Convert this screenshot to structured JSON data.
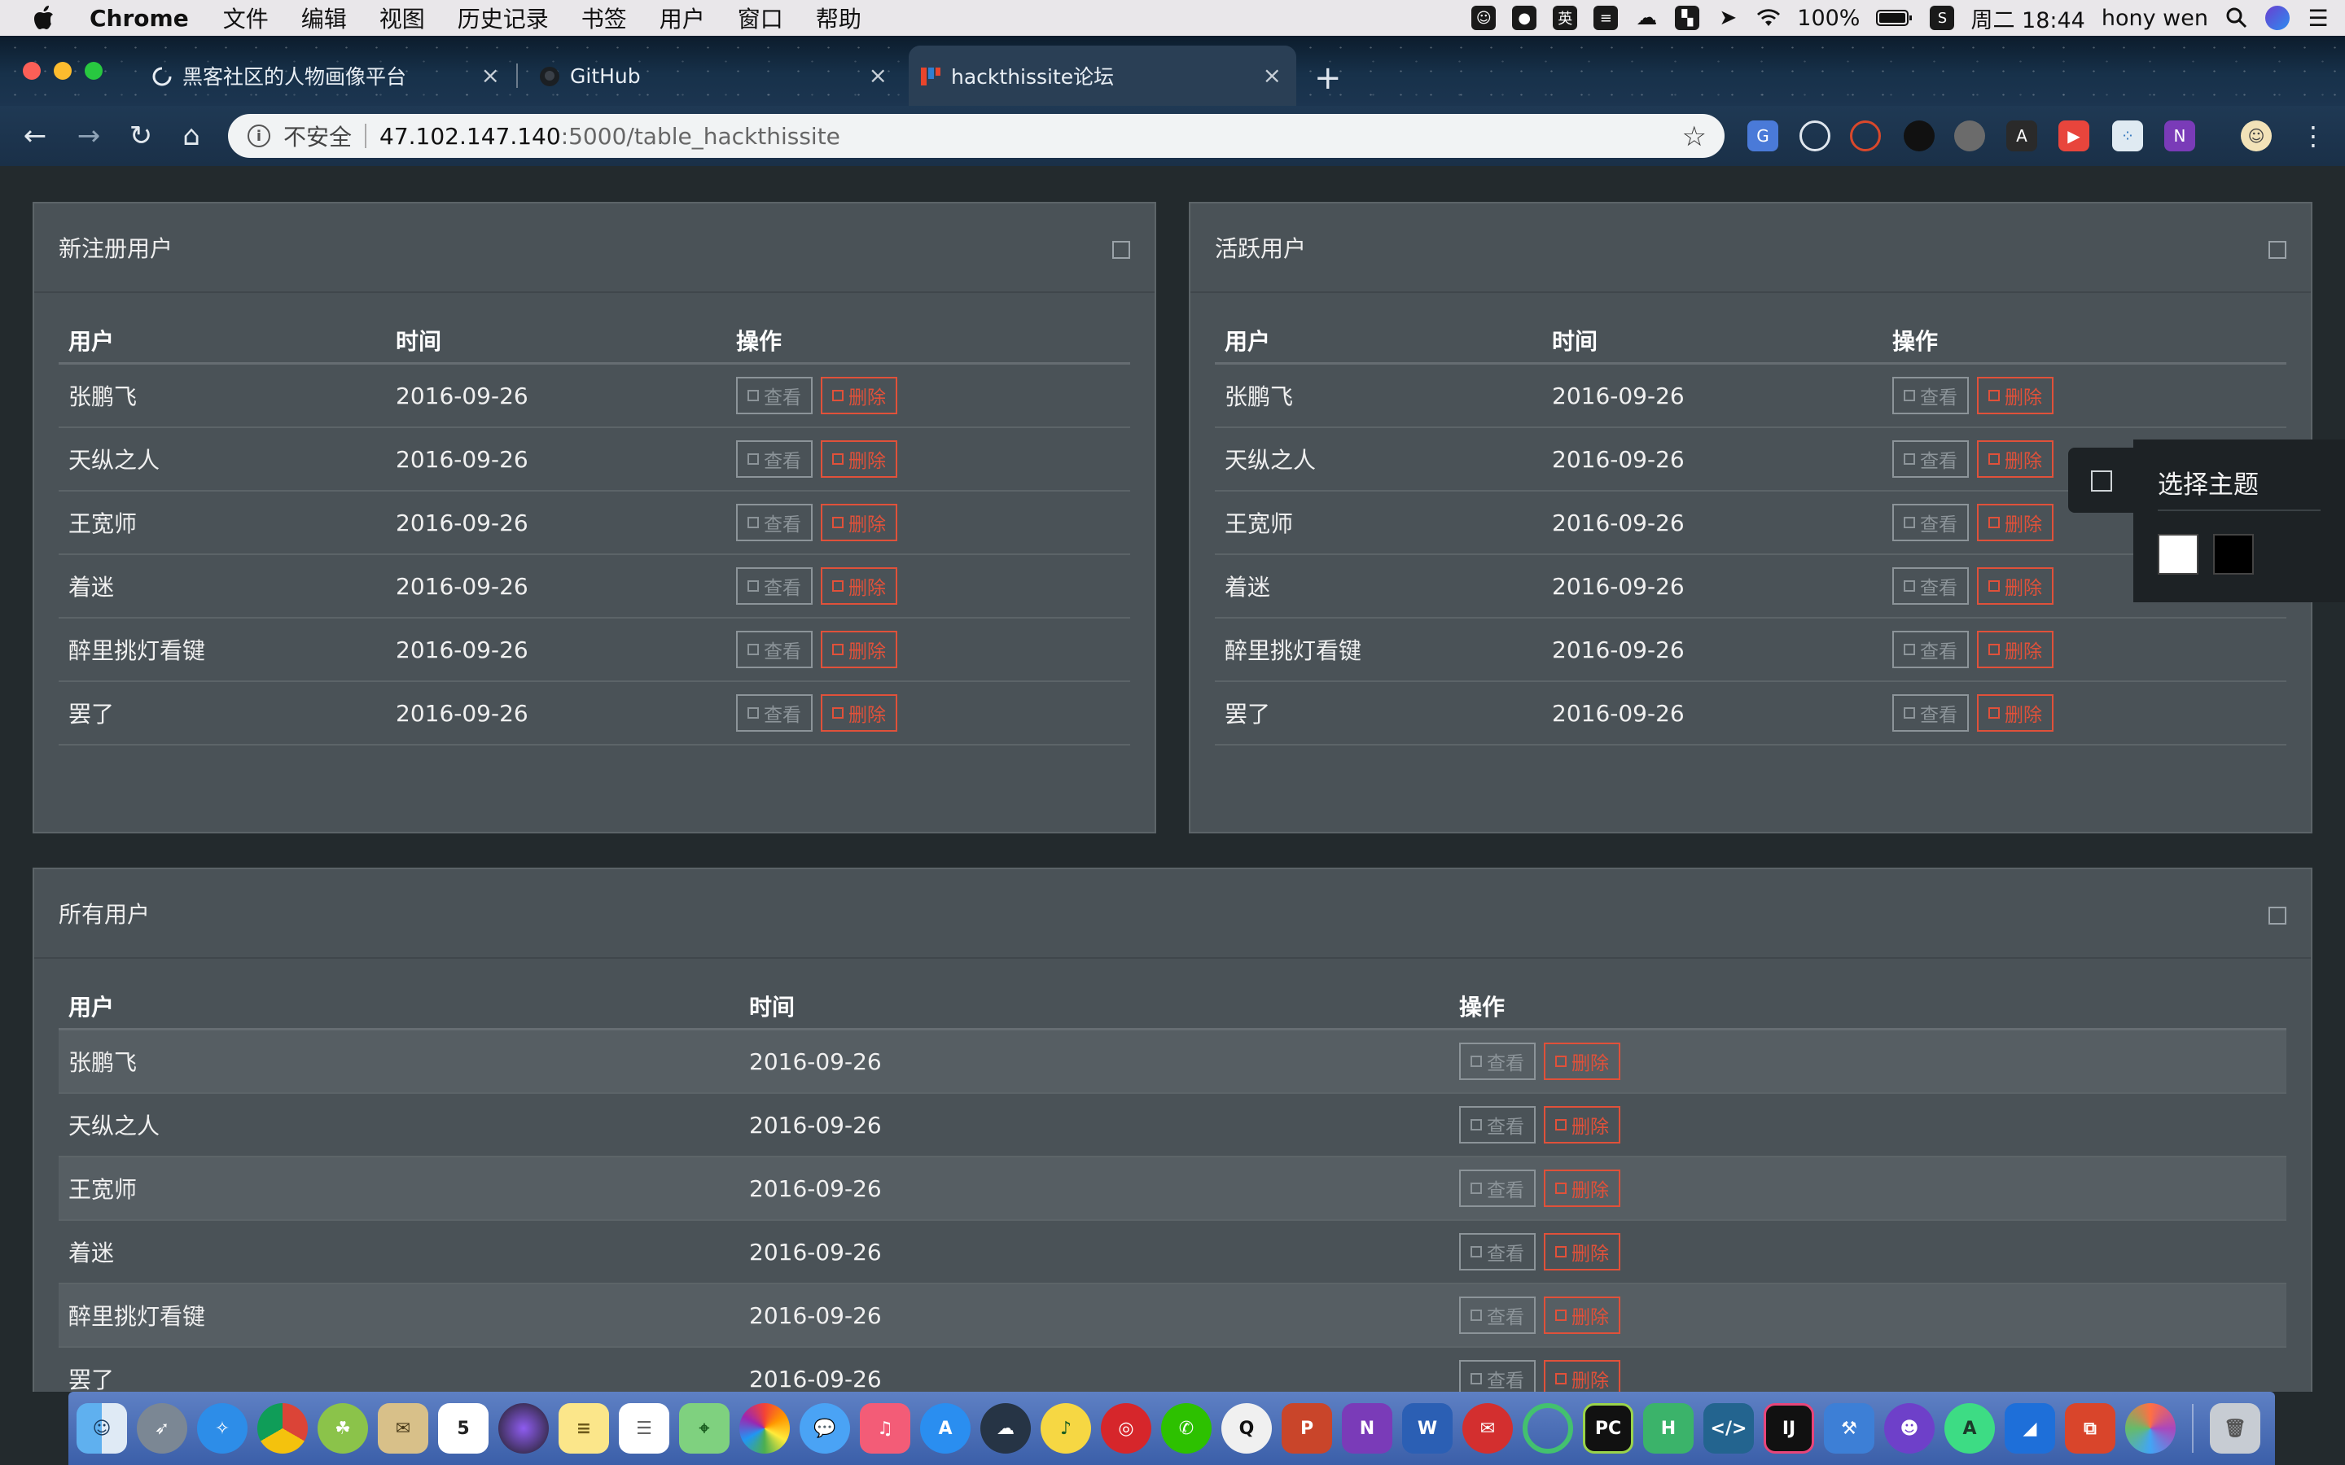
{
  "menubar": {
    "app_name": "Chrome",
    "items": [
      "文件",
      "编辑",
      "视图",
      "历史记录",
      "书签",
      "用户",
      "窗口",
      "帮助"
    ],
    "input_method": "英",
    "battery": "100%",
    "clock": "周二 18:44",
    "user": "hony wen"
  },
  "tabs": [
    {
      "title": "黑客社区的人物画像平台",
      "icon": "loading-spinner-icon"
    },
    {
      "title": "GitHub",
      "icon": "github-icon"
    },
    {
      "title": "hackthissite论坛",
      "icon": "site-favicon-icon",
      "active": true
    }
  ],
  "omnibox": {
    "security_label": "不安全",
    "host": "47.102.147.140",
    "path": ":5000/table_hackthissite"
  },
  "columns": {
    "user": "用户",
    "time": "时间",
    "action": "操作"
  },
  "buttons": {
    "view": "查看",
    "delete": "删除"
  },
  "panels": {
    "new_users": {
      "title": "新注册用户",
      "rows": [
        {
          "user": "张鹏飞",
          "time": "2016-09-26"
        },
        {
          "user": "天纵之人",
          "time": "2016-09-26"
        },
        {
          "user": "王宽师",
          "time": "2016-09-26"
        },
        {
          "user": "着迷",
          "time": "2016-09-26"
        },
        {
          "user": "醉里挑灯看键",
          "time": "2016-09-26"
        },
        {
          "user": "罢了",
          "time": "2016-09-26"
        }
      ]
    },
    "active_users": {
      "title": "活跃用户",
      "rows": [
        {
          "user": "张鹏飞",
          "time": "2016-09-26"
        },
        {
          "user": "天纵之人",
          "time": "2016-09-26"
        },
        {
          "user": "王宽师",
          "time": "2016-09-26"
        },
        {
          "user": "着迷",
          "time": "2016-09-26"
        },
        {
          "user": "醉里挑灯看键",
          "time": "2016-09-26"
        },
        {
          "user": "罢了",
          "time": "2016-09-26"
        }
      ]
    },
    "all_users": {
      "title": "所有用户",
      "rows": [
        {
          "user": "张鹏飞",
          "time": "2016-09-26"
        },
        {
          "user": "天纵之人",
          "time": "2016-09-26"
        },
        {
          "user": "王宽师",
          "time": "2016-09-26"
        },
        {
          "user": "着迷",
          "time": "2016-09-26"
        },
        {
          "user": "醉里挑灯看键",
          "time": "2016-09-26"
        },
        {
          "user": "罢了",
          "time": "2016-09-26"
        }
      ]
    }
  },
  "theme_picker": {
    "title": "选择主题",
    "options": [
      {
        "name": "light-theme",
        "color": "#ffffff"
      },
      {
        "name": "dark-theme",
        "color": "#000000"
      }
    ]
  },
  "colors": {
    "page_bg": "#232a2d",
    "panel_bg": "#4a5257",
    "delete_accent": "#e0513a",
    "view_muted": "#8c9499"
  }
}
